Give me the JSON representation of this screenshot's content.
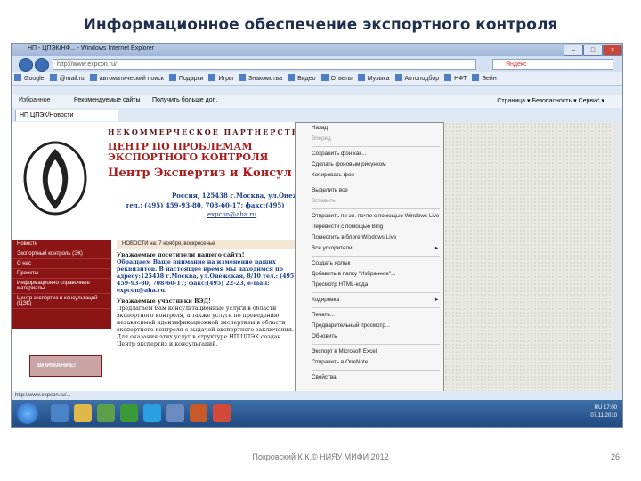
{
  "slide": {
    "title": "Информационное обеспечение экспортного контроля",
    "footer": "Покровский К.К.© НИЯУ МИФИ 2012",
    "page_number": "26"
  },
  "browser": {
    "window_title": "НП - ЦПЭК/НФ... - Windows Internet Explorer",
    "url": "http://www.expcon.ru/",
    "search_placeholder": "Яндекс",
    "toolbar_items": [
      "Google",
      "@mail.ru",
      "автоматический поиск",
      "Подарки",
      "Игры",
      "Знакомства",
      "Видео",
      "Ответы",
      "Музыка",
      "Автоподбор",
      "НФТ",
      "Бейн"
    ],
    "favorites_label": "Избранное",
    "favorites_items": [
      "Рекомендуемые сайты",
      "Получить больше доп."
    ],
    "right_tools": [
      "Страница",
      "Безопасность",
      "Сервис"
    ],
    "tab_label": "НП ЦПЭК/Новости",
    "status_text": "http://www.expcon.ru/..."
  },
  "site": {
    "org_name": "НЕКОММЕРЧЕСКОЕ ПАРТНЕРСТВО",
    "heading_line1": "ЦЕНТР ПО ПРОБЛЕМАМ",
    "heading_line2": "ЭКСПОРТНОГО КОНТРОЛЯ",
    "heading_sub": "Центр Экспертиз и Консул",
    "address": "Россия, 125438 г.Москва, ул.Онежск",
    "phone": "тел.: (495) 459-93-80, 708-60-17; факс:(495)",
    "email": "expcon@aha.ru",
    "sidebar": [
      "Новости",
      "Экспортный контроль (ЭК)",
      "О нас",
      "Проекты",
      "Информационно справочные материалы",
      "Центр экспертиз и консультаций (ЦЭК)"
    ],
    "news_header": "НОВОСТИ на: 7 ноября, воскресенье",
    "notice_title": "Уважаемые посетители нашего сайта!",
    "notice_body": "Обращаем Ваше внимание на изменение наших реквизитов. В настоящее время мы находимся по адресу:125438 г.Москва, ул.Онежская, 8/10 тел.: (495) 459-93-80, 708-60-17; факс:(495) 22-23, e-mail: expcon@aha.ru.",
    "ved_title": "Уважаемые участники ВЭД!",
    "ved_body": "Предлагаем Вам консультационные услуги в области экспортного контроля, а также услуги по проведению независимой идентификационной экспертизы в области экспортного контроля с выдачей экспертного заключения. Для оказания этих услуг в структуре НП ЦПЭК создан Центр экспертиз и консультаций.",
    "banner_text": "ВНИМАНИЕ!"
  },
  "context_menu": [
    {
      "label": "Назад",
      "dim": false
    },
    {
      "label": "Вперед",
      "dim": true
    },
    {
      "sep": true
    },
    {
      "label": "Сохранить фон как...",
      "dim": false
    },
    {
      "label": "Сделать фоновым рисунком",
      "dim": false
    },
    {
      "label": "Копировать фон",
      "dim": false
    },
    {
      "sep": true
    },
    {
      "label": "Выделить все",
      "dim": false
    },
    {
      "label": "Вставить",
      "dim": true
    },
    {
      "sep": true
    },
    {
      "label": "Отправить по эл. почте с помощью Windows Live",
      "dim": false
    },
    {
      "label": "Перевести с помощью Bing",
      "dim": false
    },
    {
      "label": "Поместить в блоге Windows Live",
      "dim": false
    },
    {
      "label": "Все ускорители",
      "dim": false,
      "arrow": true
    },
    {
      "sep": true
    },
    {
      "label": "Создать ярлык",
      "dim": false
    },
    {
      "label": "Добавить в папку \"Избранное\"...",
      "dim": false
    },
    {
      "label": "Просмотр HTML-кода",
      "dim": false
    },
    {
      "sep": true
    },
    {
      "label": "Кодировка",
      "dim": false,
      "arrow": true
    },
    {
      "sep": true
    },
    {
      "label": "Печать...",
      "dim": false
    },
    {
      "label": "Предварительный просмотр...",
      "dim": false
    },
    {
      "label": "Обновить",
      "dim": false
    },
    {
      "sep": true
    },
    {
      "label": "Экспорт в Microsoft Excel",
      "dim": false
    },
    {
      "label": "Отправить в OneNote",
      "dim": false
    },
    {
      "sep": true
    },
    {
      "label": "Свойства",
      "dim": false
    }
  ],
  "taskbar": {
    "time": "17:00",
    "date": "07.11.2010",
    "lang": "RU"
  }
}
